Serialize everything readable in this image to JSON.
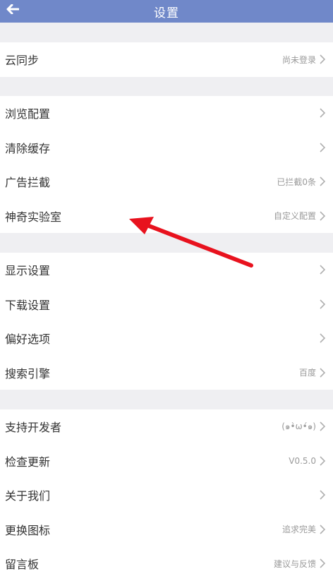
{
  "header": {
    "title": "设置"
  },
  "groups": [
    {
      "rows": [
        {
          "label": "云同步",
          "value": "尚未登录"
        }
      ]
    },
    {
      "rows": [
        {
          "label": "浏览配置",
          "value": ""
        },
        {
          "label": "清除缓存",
          "value": ""
        },
        {
          "label": "广告拦截",
          "value": "已拦截0条"
        },
        {
          "label": "神奇实验室",
          "value": "自定义配置"
        }
      ]
    },
    {
      "rows": [
        {
          "label": "显示设置",
          "value": ""
        },
        {
          "label": "下载设置",
          "value": ""
        },
        {
          "label": "偏好选项",
          "value": ""
        },
        {
          "label": "搜索引擎",
          "value": "百度"
        }
      ]
    },
    {
      "rows": [
        {
          "label": "支持开发者",
          "value": "(๑•̀ω•́๑)"
        },
        {
          "label": "检查更新",
          "value": "V0.5.0"
        },
        {
          "label": "关于我们",
          "value": ""
        },
        {
          "label": "更换图标",
          "value": "追求完美"
        },
        {
          "label": "留言板",
          "value": "建议与反馈"
        }
      ]
    }
  ],
  "colors": {
    "header": "#7088c9",
    "annotation": "#e8121e"
  },
  "icons": {
    "back": "back-arrow-icon",
    "row": "chevron-right-icon"
  }
}
